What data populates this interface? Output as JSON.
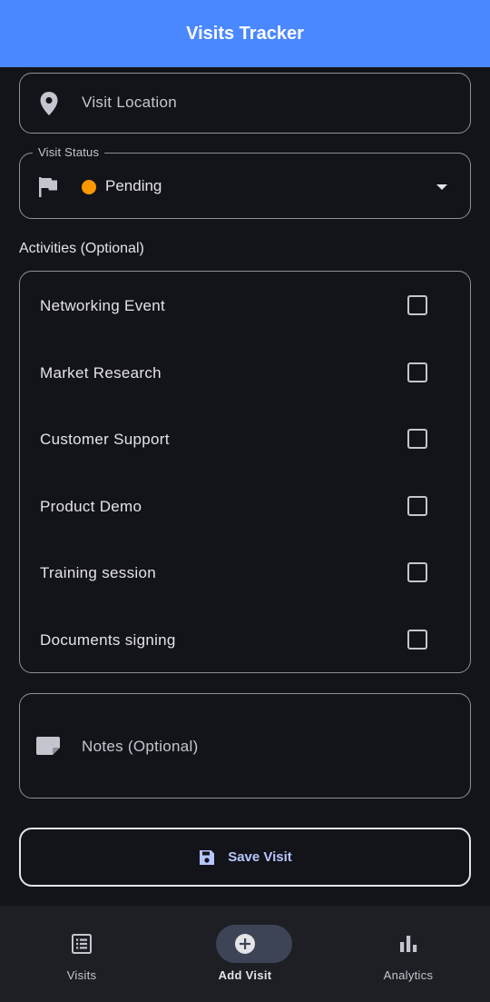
{
  "app_bar": {
    "title": "Visits Tracker"
  },
  "location": {
    "placeholder": "Visit Location",
    "icon": "location-pin-icon"
  },
  "status": {
    "legend": "Visit Status",
    "value": "Pending",
    "dot_color": "#ff9800",
    "icon": "flag-icon"
  },
  "activities": {
    "label": "Activities (Optional)",
    "items": [
      {
        "label": "Networking Event",
        "checked": false
      },
      {
        "label": "Market Research",
        "checked": false
      },
      {
        "label": "Customer Support",
        "checked": false
      },
      {
        "label": "Product Demo",
        "checked": false
      },
      {
        "label": "Training session",
        "checked": false
      },
      {
        "label": "Documents signing",
        "checked": false
      }
    ]
  },
  "notes": {
    "placeholder": "Notes (Optional)",
    "icon": "note-icon"
  },
  "save_button": {
    "label": "Save Visit",
    "icon": "save-icon"
  },
  "bottom_nav": {
    "items": [
      {
        "label": "Visits",
        "icon": "list-icon",
        "active": false
      },
      {
        "label": "Add Visit",
        "icon": "add-circle-icon",
        "active": true
      },
      {
        "label": "Analytics",
        "icon": "bar-chart-icon",
        "active": false
      }
    ]
  },
  "colors": {
    "primary": "#4a88ff",
    "background": "#131419",
    "nav_background": "#1e1f25",
    "accent_text": "#b6c6ff"
  }
}
